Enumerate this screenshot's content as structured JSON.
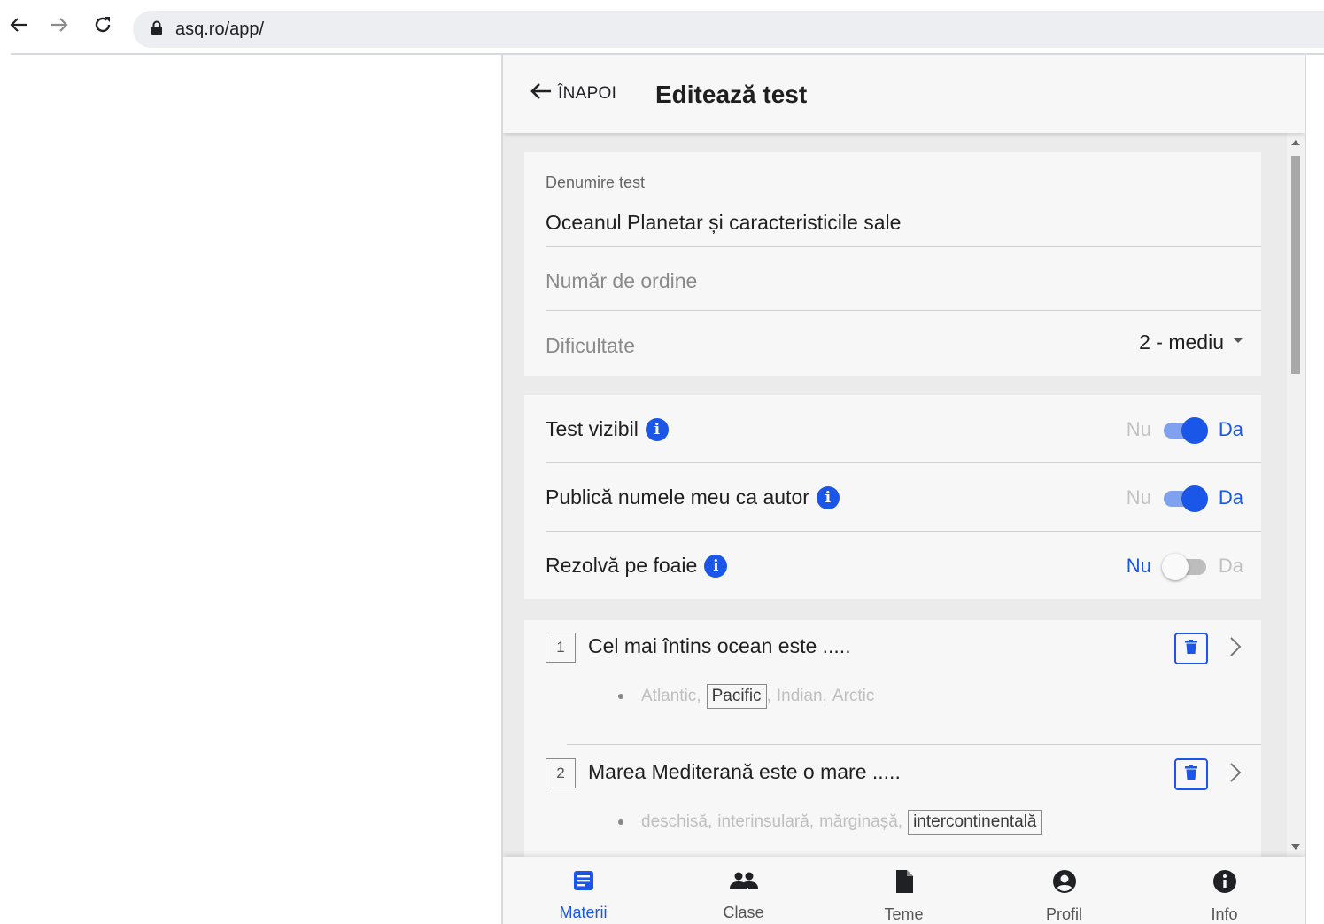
{
  "browser": {
    "url": "asq.ro/app/"
  },
  "header": {
    "back_label": "ÎNAPOI",
    "title": "Editează test"
  },
  "form": {
    "name_label": "Denumire test",
    "name_value": "Oceanul Planetar și caracteristicile sale",
    "order_placeholder": "Număr de ordine",
    "difficulty_label": "Dificultate",
    "difficulty_value": "2 - mediu"
  },
  "toggles": [
    {
      "label": "Test vizibil",
      "off_label": "Nu",
      "on_label": "Da",
      "checked": true
    },
    {
      "label": "Publică numele meu ca autor",
      "off_label": "Nu",
      "on_label": "Da",
      "checked": true
    },
    {
      "label": "Rezolvă pe foaie",
      "off_label": "Nu",
      "on_label": "Da",
      "checked": false
    }
  ],
  "questions": [
    {
      "number": "1",
      "text": "Cel mai întins ocean este .....",
      "answers": [
        "Atlantic",
        "Pacific",
        "Indian",
        "Arctic"
      ],
      "correct": "Pacific"
    },
    {
      "number": "2",
      "text": "Marea Mediterană este o mare .....",
      "answers": [
        "deschisă",
        "interinsulară",
        "mărginașă",
        "intercontinentală"
      ],
      "correct": "intercontinentală"
    }
  ],
  "bottom_nav": [
    {
      "label": "Materii",
      "icon": "book-icon",
      "active": true
    },
    {
      "label": "Clase",
      "icon": "people-icon",
      "active": false
    },
    {
      "label": "Teme",
      "icon": "file-icon",
      "active": false
    },
    {
      "label": "Profil",
      "icon": "account-icon",
      "active": false
    },
    {
      "label": "Info",
      "icon": "info-icon",
      "active": false
    }
  ],
  "colors": {
    "accent": "#1a56e8",
    "background": "#ebebeb",
    "card": "#f7f7f7"
  }
}
